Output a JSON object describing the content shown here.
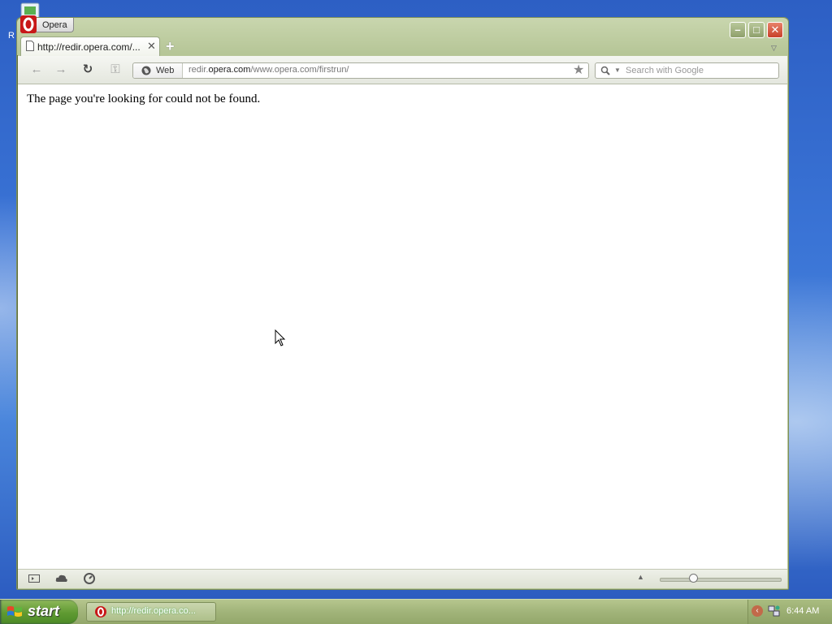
{
  "desktop": {
    "icon_label": "R"
  },
  "window": {
    "menu_button_label": "Opera",
    "controls": {
      "minimize": "–",
      "maximize": "□",
      "close": "✕"
    },
    "tabs": [
      {
        "title": "http://redir.opera.com/...",
        "close_glyph": "✕"
      }
    ],
    "new_tab_glyph": "+",
    "tab_menu_glyph": "▽"
  },
  "toolbar": {
    "back_glyph": "←",
    "forward_glyph": "→",
    "reload_glyph": "↻",
    "wand_glyph": "⚿",
    "address": {
      "site_label": "Web",
      "url_prefix": "redir.",
      "url_host": "opera.com",
      "url_path": "/www.opera.com/firstrun/",
      "bookmark_glyph": "★"
    },
    "search": {
      "placeholder": "Search with Google",
      "dropdown_glyph": "▼"
    }
  },
  "content": {
    "message": "The page you're looking for could not be found."
  },
  "statusbar": {
    "up_glyph": "▲"
  },
  "taskbar": {
    "start_label": "start",
    "tasks": [
      {
        "label": "http://redir.opera.co..."
      }
    ],
    "tray_chevron": "‹",
    "clock": "6:44 AM"
  },
  "colors": {
    "window_frame": "#b8c79a",
    "close_button": "#c8402a",
    "start_button": "#5f9a32",
    "desktop": "#3a74d6"
  }
}
